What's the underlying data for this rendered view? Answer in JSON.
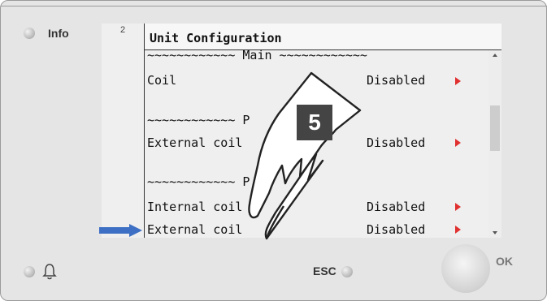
{
  "device": {
    "info_label": "Info",
    "esc_label": "ESC",
    "ok_label": "OK"
  },
  "screen": {
    "number": "2",
    "title": "Unit Configuration",
    "rows": [
      {
        "text": "~~~~~~~~~~~~ Main ~~~~~~~~~~~~"
      },
      {
        "text": "Coil",
        "value": "Disabled"
      },
      {
        "text": "~~~~~~~~~~~~ P"
      },
      {
        "text": "External coil",
        "value": "Disabled"
      },
      {
        "text": "~~~~~~~~~~~~ P"
      },
      {
        "text": "Internal coil",
        "value": "Disabled"
      },
      {
        "text": "External coil",
        "value": "Disabled",
        "selected": true
      }
    ]
  },
  "step_badge": "5",
  "colors": {
    "indicator_arrow": "#3d6fc4",
    "value_arrow": "#e03030",
    "badge": "#444444"
  },
  "icons": [
    "bell-icon",
    "hand-pointer-icon",
    "selection-arrow-icon",
    "value-arrow-icon"
  ]
}
